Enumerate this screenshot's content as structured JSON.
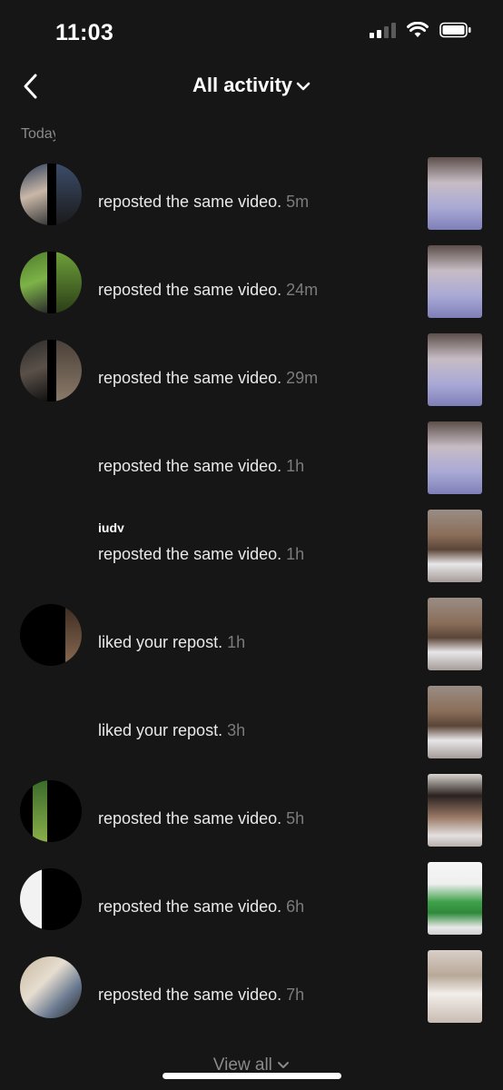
{
  "status": {
    "time": "11:03"
  },
  "header": {
    "title": "All activity"
  },
  "section_label": "Today",
  "items": [
    {
      "text": "reposted the same video.",
      "time": "5m",
      "thumb": "car-selfie-hijab",
      "avatar": "user-avatar"
    },
    {
      "text": "reposted the same video.",
      "time": "24m",
      "thumb": "car-selfie-hijab",
      "avatar": "user-avatar"
    },
    {
      "text": "reposted the same video.",
      "time": "29m",
      "thumb": "car-selfie-hijab",
      "avatar": "user-avatar"
    },
    {
      "text": "reposted the same video.",
      "time": "1h",
      "thumb": "car-selfie-hijab",
      "avatar": "user-avatar"
    },
    {
      "text": "reposted the same video.",
      "time": "1h",
      "thumb": "man-white-shirt",
      "avatar": "user-avatar",
      "name": "judy"
    },
    {
      "text": "liked your repost.",
      "time": "1h",
      "thumb": "man-white-shirt",
      "avatar": "user-avatar"
    },
    {
      "text": "liked your repost.",
      "time": "3h",
      "thumb": "man-white-shirt",
      "avatar": "user-avatar"
    },
    {
      "text": "reposted the same video.",
      "time": "5h",
      "thumb": "curly-hair-man",
      "avatar": "user-avatar"
    },
    {
      "text": "reposted the same video.",
      "time": "6h",
      "thumb": "green-hoodie",
      "avatar": "user-avatar"
    },
    {
      "text": "reposted the same video.",
      "time": "7h",
      "thumb": "dancing-man",
      "avatar": "user-avatar"
    }
  ],
  "footer": {
    "view_all": "View all"
  },
  "colors": {
    "background": "#161616",
    "muted": "#7c7c7c",
    "text": "#e9e9e9"
  }
}
